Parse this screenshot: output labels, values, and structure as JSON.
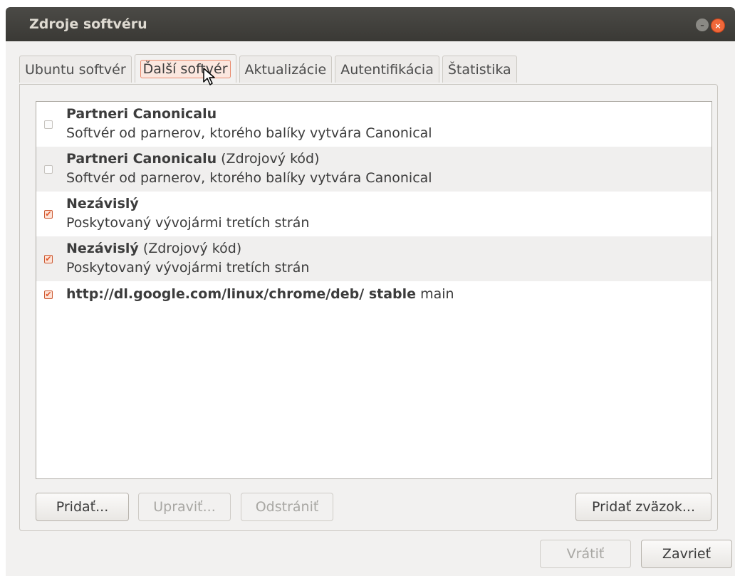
{
  "window": {
    "title": "Zdroje softvéru"
  },
  "tabs": [
    {
      "label": "Ubuntu softvér"
    },
    {
      "label": "Ďalší softvér"
    },
    {
      "label": "Aktualizácie"
    },
    {
      "label": "Autentifikácia"
    },
    {
      "label": "Štatistika"
    }
  ],
  "sources": [
    {
      "checked": false,
      "name": "Partneri Canonicalu",
      "suffix": "",
      "desc": "Softvér od parnerov, ktorého balíky vytvára Canonical"
    },
    {
      "checked": false,
      "name": "Partneri Canonicalu",
      "suffix": " (Zdrojový kód)",
      "desc": "Softvér od parnerov, ktorého balíky vytvára Canonical"
    },
    {
      "checked": true,
      "name": "Nezávislý",
      "suffix": "",
      "desc": "Poskytovaný vývojármi tretích strán"
    },
    {
      "checked": true,
      "name": "Nezávislý",
      "suffix": " (Zdrojový kód)",
      "desc": "Poskytovaný vývojármi tretích strán"
    },
    {
      "checked": true,
      "name": "http://dl.google.com/linux/chrome/deb/ stable",
      "suffix": " main"
    }
  ],
  "buttons": {
    "add": "Pridať...",
    "edit": "Upraviť...",
    "remove": "Odstrániť",
    "add_key": "Pridať zväzok...",
    "revert": "Vrátiť",
    "close": "Zavrieť"
  },
  "checkmark": "✔",
  "colors": {
    "accent": "#e0562a",
    "titlebar": "#3c3b37",
    "window_bg": "#f2f1f0"
  }
}
